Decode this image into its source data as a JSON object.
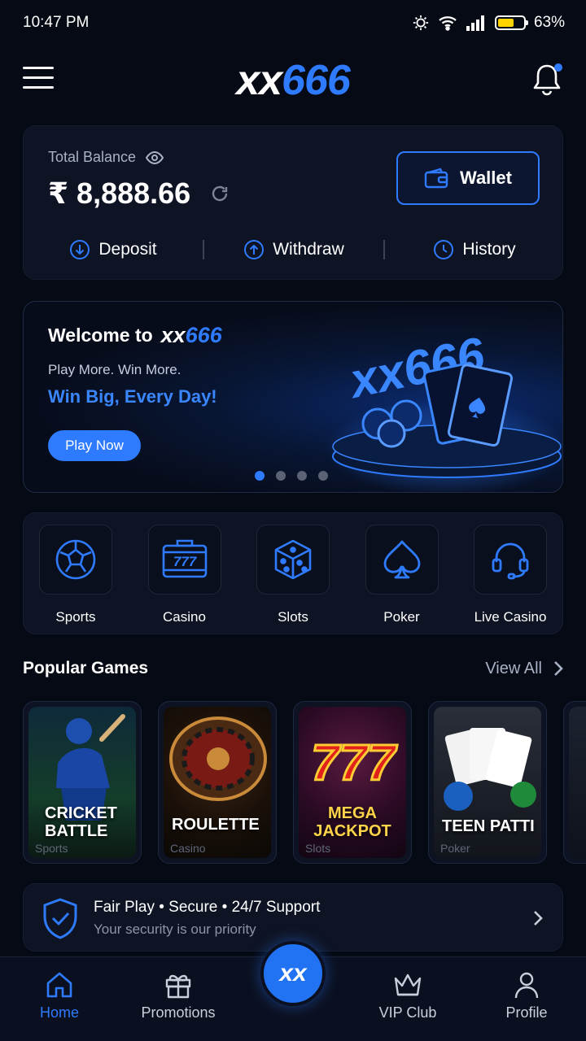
{
  "status": {
    "time": "10:47 PM",
    "battery": "63%",
    "battery_level": 0.63
  },
  "header": {
    "logo_xx": "xx",
    "logo_num": "666",
    "notification_dot": true
  },
  "balance": {
    "label": "Total Balance",
    "amount": "₹ 8,888.66",
    "wallet_label": "Wallet",
    "actions": [
      {
        "label": "Deposit",
        "icon": "arrow-down-circle-icon"
      },
      {
        "label": "Withdraw",
        "icon": "arrow-up-circle-icon"
      },
      {
        "label": "History",
        "icon": "history-icon"
      }
    ]
  },
  "banner": {
    "welcome": "Welcome to",
    "logo_xx": "xx",
    "logo_num": "666",
    "tagline": "Play More. Win More.",
    "headline": "Win Big, Every Day!",
    "cta": "Play Now",
    "slides": 4,
    "active_slide": 1
  },
  "categories": [
    {
      "label": "Sports",
      "icon": "soccer-ball-icon"
    },
    {
      "label": "Casino",
      "icon": "slot-777-icon"
    },
    {
      "label": "Slots",
      "icon": "dice-icon"
    },
    {
      "label": "Poker",
      "icon": "spade-icon"
    },
    {
      "label": "Live Casino",
      "icon": "headset-icon"
    }
  ],
  "popular": {
    "title": "Popular Games",
    "view_all": "View All",
    "games": [
      {
        "title_line1": "CRICKET",
        "title_line2": "BATTLE",
        "sub": "Sports"
      },
      {
        "title_line1": "ROULETTE",
        "title_line2": "",
        "sub": "Casino"
      },
      {
        "title_line1": "MEGA",
        "title_line2": "JACKPOT",
        "sub": "Slots"
      },
      {
        "title_line1": "TEEN PATTI",
        "title_line2": "",
        "sub": "Poker"
      }
    ]
  },
  "trust": {
    "title": "Fair Play • Secure • 24/7 Support",
    "subtitle": "Your security is our priority"
  },
  "nav": {
    "home": "Home",
    "promotions": "Promotions",
    "center": "xx",
    "vip": "VIP Club",
    "profile": "Profile"
  },
  "colors": {
    "accent": "#2f7bff",
    "background": "#060a14",
    "card": "#0e1424",
    "battery": "#ffd400"
  }
}
